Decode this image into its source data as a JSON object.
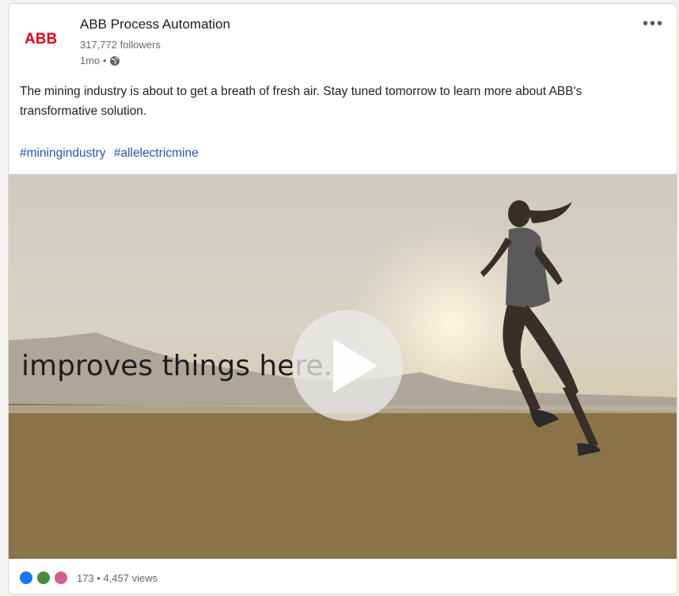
{
  "post": {
    "author": "ABB Process Automation",
    "logo_text": "ABB",
    "followers": "317,772 followers",
    "time": "1mo •",
    "more_label": "•••",
    "text": "The mining industry is about to get a breath of fresh air. Stay tuned tomorrow to learn more about ABB's transformative solution.",
    "hashtags": [
      "#miningindustry",
      "#allelectricmine"
    ],
    "video_caption": "improves things here.",
    "counts": "173 • 4,457 views"
  },
  "colors": {
    "brand": "#e2001a",
    "link": "#2557a7",
    "like": "#1877f2",
    "celebrate": "#4a8a3a",
    "love": "#d35f8a"
  }
}
